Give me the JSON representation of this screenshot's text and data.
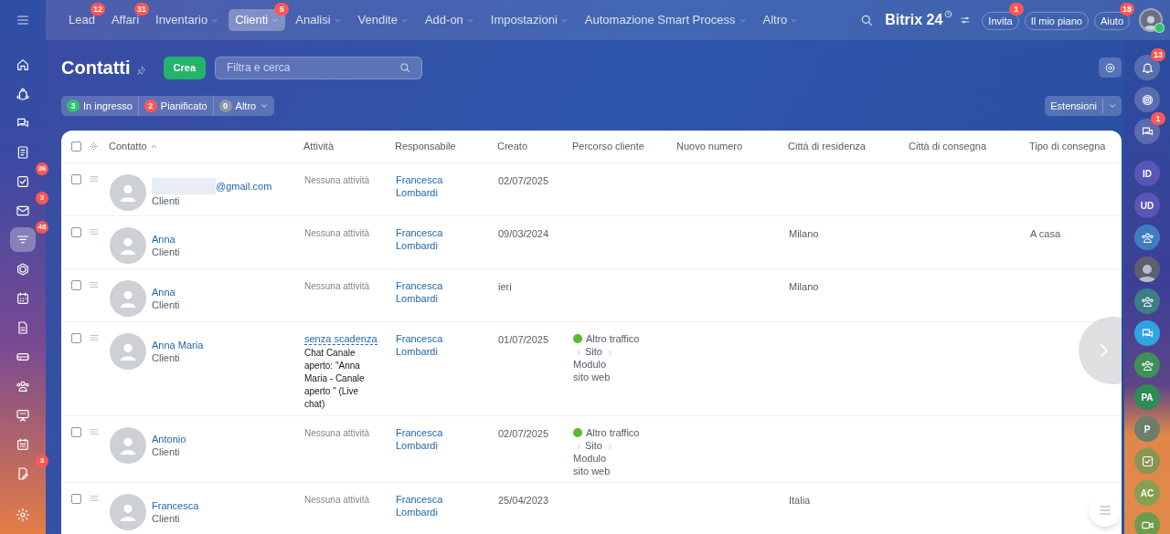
{
  "nav": {
    "items": [
      {
        "label": "Lead",
        "badge": "12",
        "dropdown": false,
        "selected": false
      },
      {
        "label": "Affari",
        "badge": "31",
        "dropdown": false,
        "selected": false
      },
      {
        "label": "Inventario",
        "dropdown": true,
        "selected": false
      },
      {
        "label": "Clienti",
        "badge": "5",
        "dropdown": true,
        "selected": true
      },
      {
        "label": "Analisi",
        "dropdown": true,
        "selected": false
      },
      {
        "label": "Vendite",
        "dropdown": true,
        "selected": false
      },
      {
        "label": "Add-on",
        "dropdown": true,
        "selected": false
      },
      {
        "label": "Impostazioni",
        "dropdown": true,
        "selected": false
      },
      {
        "label": "Automazione Smart Process",
        "dropdown": true,
        "selected": false
      },
      {
        "label": "Altro",
        "dropdown": true,
        "selected": false
      }
    ]
  },
  "brand": {
    "name": "Bitrix",
    "suffix": "24"
  },
  "header_buttons": [
    {
      "label": "Invita",
      "badge": "1"
    },
    {
      "label": "Il mio piano"
    },
    {
      "label": "Aiuto",
      "badge": "18"
    }
  ],
  "sidebar": {
    "items": [
      {
        "selected": false
      },
      {
        "selected": false
      },
      {
        "selected": false
      },
      {
        "selected": false
      },
      {
        "badge": "36",
        "selected": false
      },
      {
        "badge": "3",
        "selected": false
      },
      {
        "badge": "48",
        "selected": true
      },
      {
        "selected": false
      },
      {
        "selected": false
      },
      {
        "selected": false
      },
      {
        "selected": false
      },
      {
        "selected": false
      },
      {
        "selected": false
      },
      {
        "selected": false
      },
      {
        "badge": "3",
        "selected": false
      },
      {
        "selected": false
      }
    ]
  },
  "page": {
    "title": "Contatti",
    "create_button": "Crea",
    "search": {
      "placeholder": "Filtra e cerca"
    }
  },
  "counters": [
    {
      "count": "3",
      "label": "In ingresso",
      "color": "#2fc26e",
      "dropdown": false
    },
    {
      "count": "2",
      "label": "Pianificato",
      "color": "#ff5752",
      "dropdown": false
    },
    {
      "count": "0",
      "label": "Altro",
      "color": "#8d97a8",
      "dropdown": true
    }
  ],
  "extensions_button": "Estensioni",
  "table": {
    "select_all_checked": false,
    "columns": [
      {
        "label": "Contatto",
        "sorted": true
      },
      {
        "label": "Attività",
        "sorted": false
      },
      {
        "label": "Responsabile",
        "sorted": false
      },
      {
        "label": "Creato",
        "sorted": false
      },
      {
        "label": "Percorso cliente",
        "sorted": false
      },
      {
        "label": "Nuovo numero",
        "sorted": false
      },
      {
        "label": "Città di residenza",
        "sorted": false
      },
      {
        "label": "Città di consegna",
        "sorted": false
      },
      {
        "label": "Tipo di consegna",
        "sorted": false
      }
    ],
    "rows": [
      {
        "checked": false,
        "name": "@gmail.com",
        "redacted": true,
        "type": "Clienti",
        "activity": {
          "kind": "none",
          "text": "Nessuna attività"
        },
        "responsible": [
          "Francesca",
          "Lombardi"
        ],
        "created": "02/07/2025"
      },
      {
        "checked": false,
        "name": "Anna",
        "type": "Clienti",
        "activity": {
          "kind": "none",
          "text": "Nessuna attività"
        },
        "responsible": [
          "Francesca",
          "Lombardi"
        ],
        "created": "09/03/2024",
        "city": "Milano",
        "delivery_type": "A casa"
      },
      {
        "checked": false,
        "name": "Anna",
        "type": "Clienti",
        "activity": {
          "kind": "none",
          "text": "Nessuna attività"
        },
        "responsible": [
          "Francesca",
          "Lombardi"
        ],
        "created": "ieri",
        "city": "Milano"
      },
      {
        "checked": false,
        "name": "Anna Maria",
        "type": "Clienti",
        "activity": {
          "kind": "task",
          "link": "senza scadenza",
          "text": "Chat Canale aperto: \"Anna Maria - Canale aperto \" (Live chat)"
        },
        "responsible": [
          "Francesca",
          "Lombardi"
        ],
        "created": "01/07/2025",
        "journey": {
          "source": "Altro traffico",
          "steps": [
            "Sito",
            "Modulo sito web"
          ]
        }
      },
      {
        "checked": false,
        "name": "Antonio",
        "type": "Clienti",
        "activity": {
          "kind": "none",
          "text": "Nessuna attività"
        },
        "responsible": [
          "Francesca",
          "Lombardi"
        ],
        "created": "02/07/2025",
        "journey": {
          "source": "Altro traffico",
          "steps": [
            "Sito",
            "Modulo sito web"
          ]
        }
      },
      {
        "checked": false,
        "name": "Francesca",
        "type": "Clienti",
        "activity": {
          "kind": "none",
          "text": "Nessuna attività"
        },
        "responsible": [
          "Francesca",
          "Lombardi"
        ],
        "created": "25/04/2023",
        "city": "Italia"
      }
    ]
  },
  "right_bar": {
    "items": [
      {
        "kind": "bell",
        "badge": "13"
      },
      {
        "kind": "spiral"
      },
      {
        "kind": "chat",
        "badge": "1"
      },
      {
        "kind": "initials",
        "text": "ID",
        "color": "#5a55b8"
      },
      {
        "kind": "initials",
        "text": "UD",
        "color": "#5a55b8"
      },
      {
        "kind": "group",
        "color": "#3f7cc0"
      },
      {
        "kind": "photo"
      },
      {
        "kind": "group",
        "color": "#3d7d86"
      },
      {
        "kind": "chat",
        "color": "#2ea4e0"
      },
      {
        "kind": "group",
        "color": "#3f8f5a"
      },
      {
        "kind": "initials",
        "text": "PA",
        "color": "#2f8a55"
      },
      {
        "kind": "initials",
        "text": "P",
        "color": "#6c7e6a"
      },
      {
        "kind": "check",
        "color": "#8a9650"
      },
      {
        "kind": "initials",
        "text": "AC",
        "color": "#86a050"
      },
      {
        "kind": "video",
        "color": "#6f9a4c"
      }
    ]
  }
}
